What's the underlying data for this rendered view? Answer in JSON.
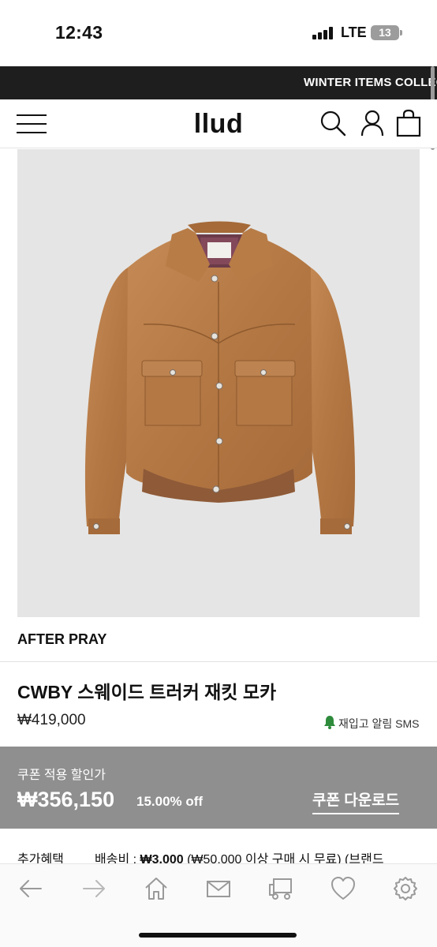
{
  "status": {
    "time": "12:43",
    "network": "LTE",
    "battery": "13"
  },
  "promo": {
    "text": "WINTER ITEMS COLLECTION"
  },
  "header": {
    "logo": "llud",
    "icons": [
      "menu-icon",
      "search-icon",
      "user-icon",
      "shopping-bag-icon"
    ]
  },
  "product": {
    "brand": "AFTER PRAY",
    "name": "CWBY 스웨이드 트러커 재킷 모카",
    "price": "₩419,000",
    "restock_alert": "재입고 알림 SMS",
    "image_alt": "suede trucker jacket in mocha"
  },
  "coupon": {
    "label": "쿠폰 적용 할인가",
    "price": "₩356,150",
    "discount": "15.00% off",
    "download_label": "쿠폰 다운로드"
  },
  "benefits": {
    "label": "추가혜택",
    "shipping_prefix": "배송비 : ",
    "shipping_fee": "₩3,000",
    "shipping_note": " (₩50,000 이상 구매 시 무료) (브랜드"
  },
  "toolbar": {
    "icons": [
      "back-arrow-icon",
      "forward-arrow-icon",
      "home-icon",
      "mail-icon",
      "truck-icon",
      "heart-icon",
      "settings-icon"
    ]
  },
  "colors": {
    "promo_bg": "#1e1e1e",
    "coupon_bg": "#8f8f8f",
    "jacket": "#b57a47",
    "bell": "#2e8b3c"
  }
}
